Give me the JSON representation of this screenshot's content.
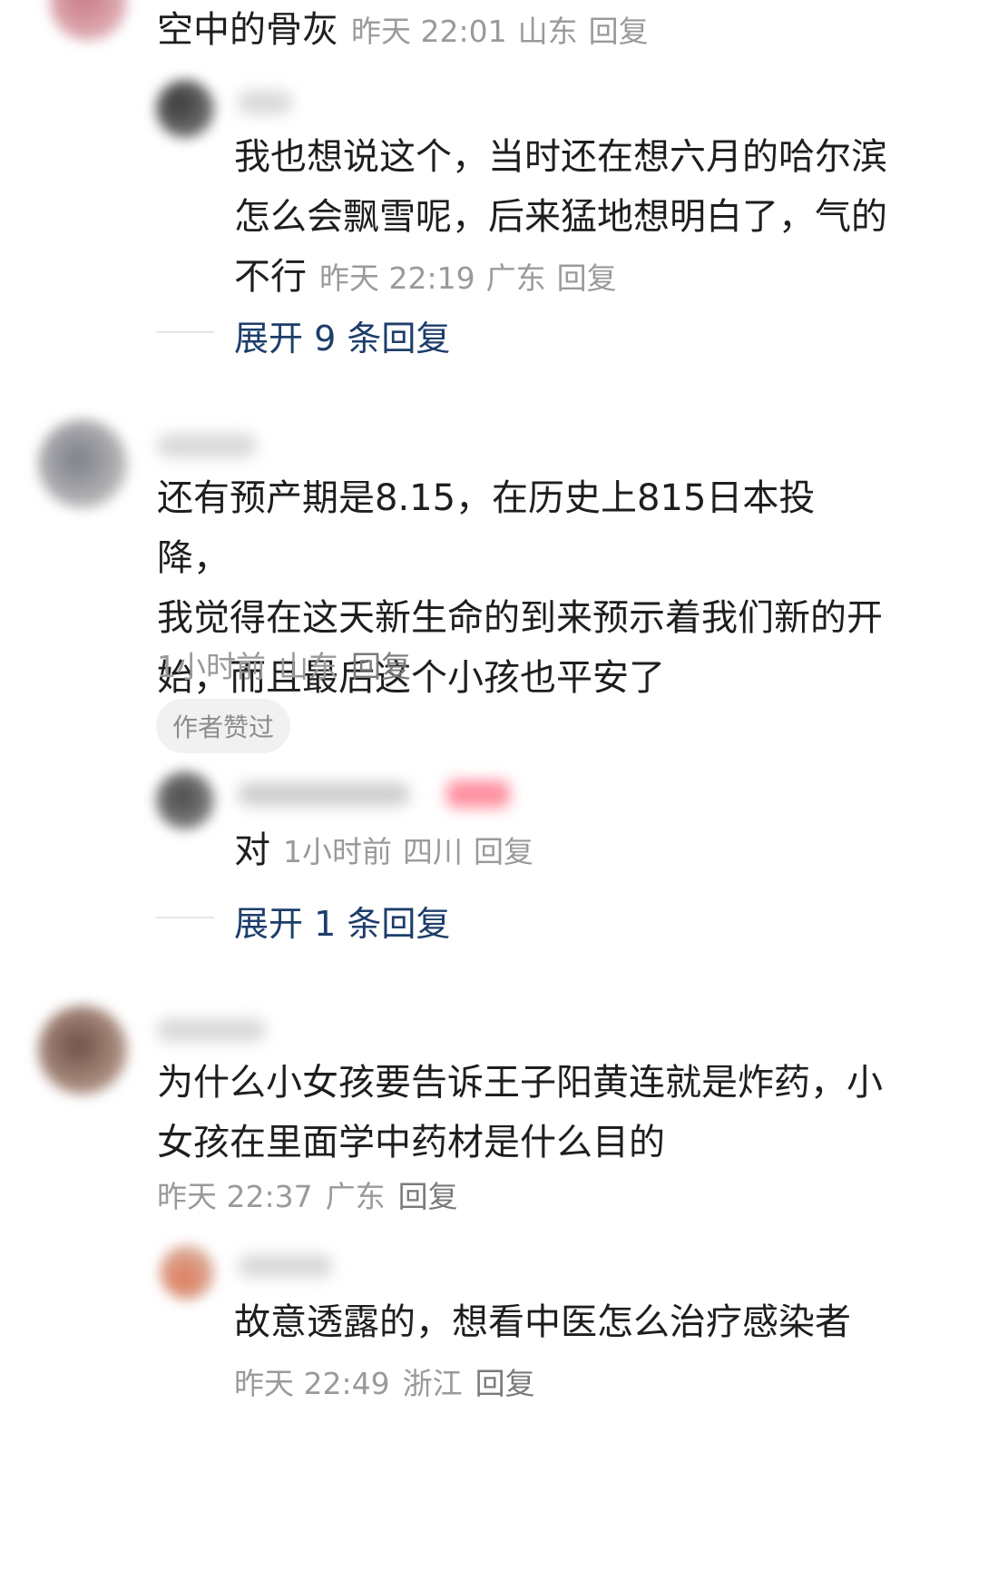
{
  "comments": [
    {
      "text": "空中的骨灰",
      "time": "昨天 22:01",
      "location": "山东",
      "reply": "回复",
      "replies": [
        {
          "text_lines": [
            "我也想说这个，当时还在想六月的哈尔滨",
            "怎么会飘雪呢，后来猛地想明白了，气的",
            "不行"
          ],
          "time": "昨天 22:19",
          "location": "广东",
          "reply": "回复"
        }
      ],
      "expand_label": "展开 9 条回复"
    },
    {
      "text_lines": [
        "还有预产期是8.15，在历史上815日本投降，",
        "我觉得在这天新生命的到来预示着我们新的开",
        "始，而且最后这个小孩也平安了"
      ],
      "time": "1小时前",
      "location": "山东",
      "reply": "回复",
      "badge": "作者赞过",
      "replies": [
        {
          "text": "对",
          "time": "1小时前",
          "location": "四川",
          "reply": "回复"
        }
      ],
      "expand_label": "展开 1 条回复"
    },
    {
      "text_lines": [
        "为什么小女孩要告诉王子阳黄连就是炸药，小",
        "女孩在里面学中药材是什么目的"
      ],
      "time": "昨天 22:37",
      "location": "广东",
      "reply": "回复",
      "replies": [
        {
          "text": "故意透露的，想看中医怎么治疗感染者",
          "time": "昨天 22:49",
          "location": "浙江",
          "reply": "回复"
        }
      ]
    }
  ]
}
